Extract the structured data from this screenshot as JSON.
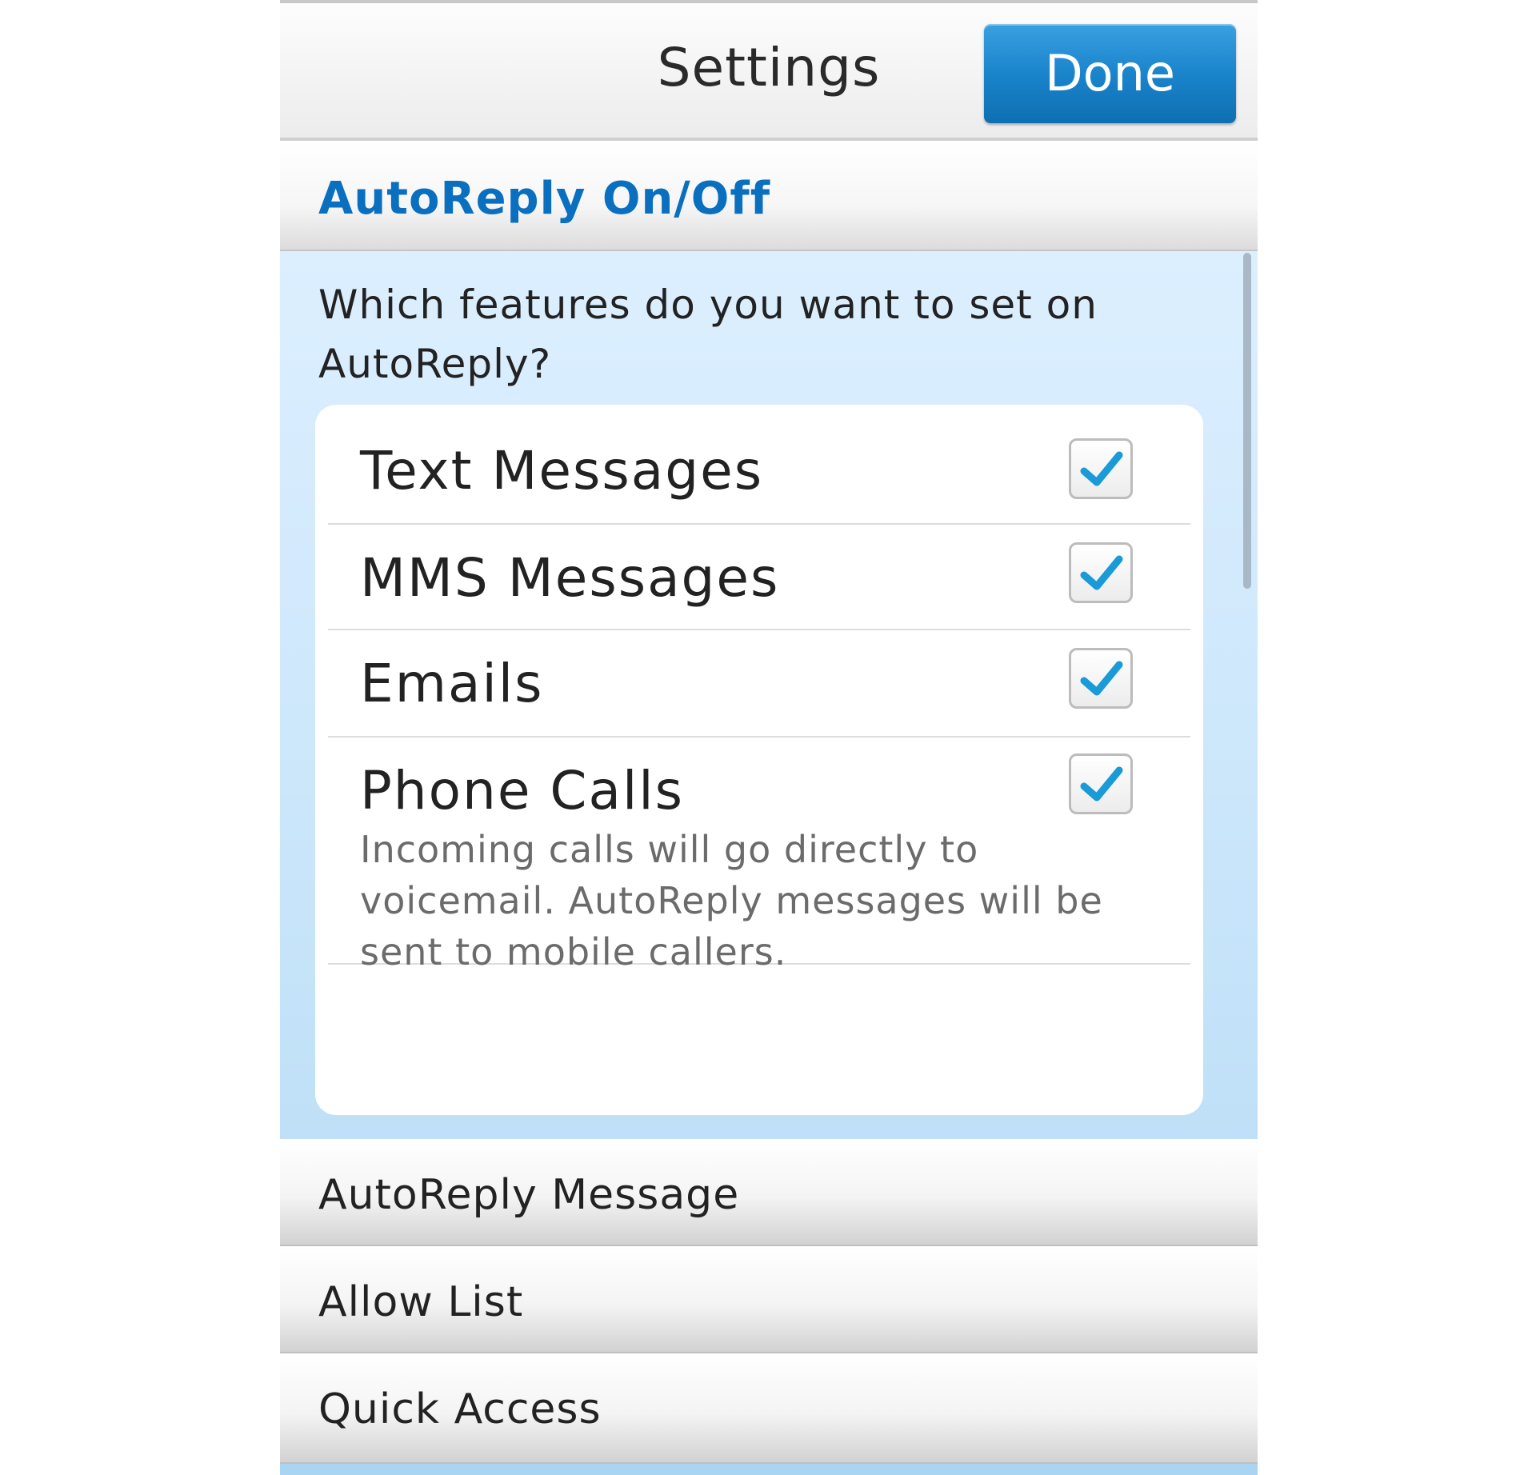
{
  "header": {
    "title": "Settings",
    "done_label": "Done"
  },
  "section": {
    "title": "AutoReply On/Off",
    "question": "Which features do you want to set on AutoReply?"
  },
  "options": [
    {
      "label": "Text Messages",
      "checked": true,
      "description": ""
    },
    {
      "label": "MMS Messages",
      "checked": true,
      "description": ""
    },
    {
      "label": "Emails",
      "checked": true,
      "description": ""
    },
    {
      "label": "Phone Calls",
      "checked": true,
      "description": "Incoming calls will go directly to voicemail. AutoReply messages will be sent to mobile callers."
    }
  ],
  "menu": [
    {
      "label": "AutoReply Message"
    },
    {
      "label": "Allow List"
    },
    {
      "label": "Quick Access"
    }
  ],
  "colors": {
    "accent": "#0a6fbf",
    "button": "#1a84cc",
    "check": "#1a9ad6",
    "panel": "#cfe8fb"
  }
}
